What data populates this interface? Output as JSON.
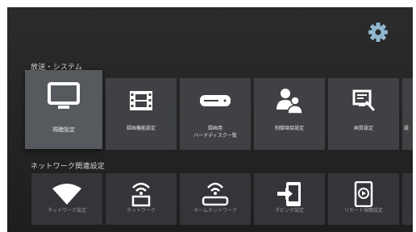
{
  "colors": {
    "accent_gear": "#8fb7d0",
    "icon": "#ffffff",
    "tile": "#3f4144",
    "tile_selected": "#56595d"
  },
  "sections": {
    "broadcast": {
      "title": "放送・システム",
      "tiles": [
        {
          "label": "視聴設定",
          "icon": "tv-icon",
          "selected": true
        },
        {
          "label": "録画機能設定",
          "icon": "film-icon"
        },
        {
          "label": "録画用\nハードディスク一覧",
          "icon": "hard-disk-icon"
        },
        {
          "label": "制御項目設定",
          "icon": "users-icon"
        },
        {
          "label": "画質設定",
          "icon": "screen-settings-icon"
        },
        {
          "label": "設",
          "icon": "partial-icon"
        }
      ]
    },
    "network": {
      "title": "ネットワーク関連設定",
      "tiles": [
        {
          "label": "ネットワーク設定",
          "icon": "wifi-icon"
        },
        {
          "label": "ネットワーク",
          "icon": "tv-wifi-icon"
        },
        {
          "label": "ホームネットワーク",
          "icon": "router-icon"
        },
        {
          "label": "ダビング設定",
          "icon": "tablet-import-icon"
        },
        {
          "label": "リモート視聴設定",
          "icon": "tablet-play-icon"
        },
        {
          "label": "",
          "icon": "partial-icon"
        }
      ]
    }
  }
}
